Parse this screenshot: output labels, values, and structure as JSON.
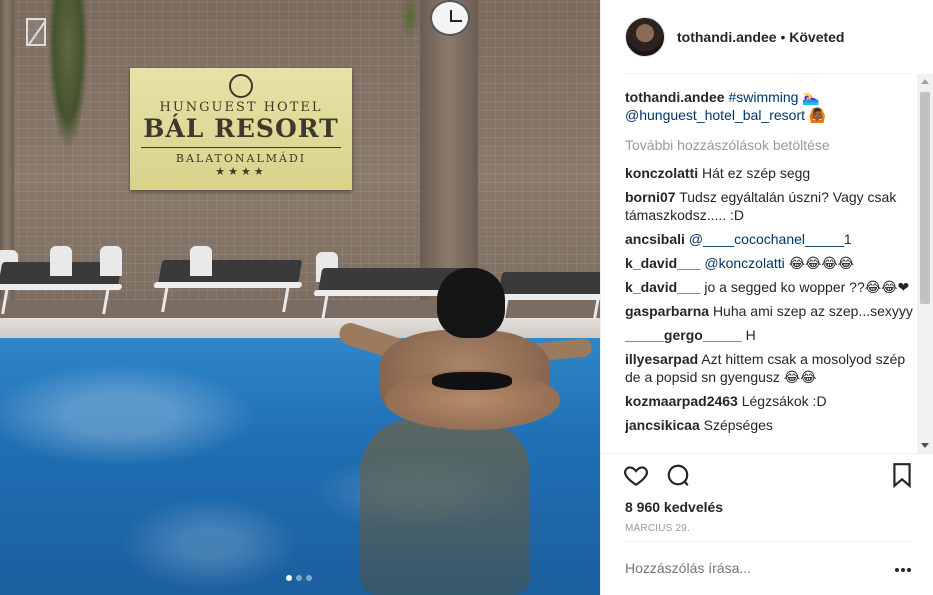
{
  "post": {
    "username": "tothandi.andee",
    "separator": "•",
    "follow_status": "Követed",
    "caption_user": "tothandi.andee",
    "caption_hashtag": "#swimming",
    "caption_tail": "🏊‍♀️",
    "caption_mention": "@hunguest_hotel_bal_resort",
    "caption_emoji": "🙆🏾"
  },
  "photo": {
    "sign": {
      "line1": "HUNGUEST HOTEL",
      "line2": "BÁL RESORT",
      "line3": "BALATONALMÁDI",
      "stars": "★★★★"
    },
    "carousel_count": 3,
    "carousel_active": 0
  },
  "comments": {
    "load_more": "További hozzászólások betöltése",
    "items": [
      {
        "user": "konczolatti",
        "text": "Hát ez szép segg"
      },
      {
        "user": "borni07",
        "text": "Tudsz egyáltalán úszni? Vagy csak támaszkodsz..... :D"
      },
      {
        "user": "ancsibali",
        "mention": "@____cocochanel_____1",
        "text": ""
      },
      {
        "user": "k_david___",
        "mention": "@konczolatti",
        "text": "😂😂😂😂"
      },
      {
        "user": "k_david___",
        "text": "jo a segged ko wopper ??😂😂❤"
      },
      {
        "user": "gasparbarna",
        "text": "Huha ami szep az szep...sexyyy"
      },
      {
        "user": "_____gergo_____",
        "text": "H"
      },
      {
        "user": "illyesarpad",
        "text": "Azt hittem csak a mosolyod szép de a popsid sn gyengusz 😂😂"
      },
      {
        "user": "kozmaarpad2463",
        "text": "Légzsákok :D"
      },
      {
        "user": "jancsikicaa",
        "text": "Szépséges"
      }
    ]
  },
  "actions": {
    "like_icon": "heart-icon",
    "comment_icon": "comment-icon",
    "save_icon": "bookmark-icon",
    "likes_text": "8 960 kedvelés",
    "date_text": "MÁRCIUS 29.",
    "add_comment_placeholder": "Hozzászólás írása...",
    "more_icon": "more-options-icon"
  },
  "colors": {
    "link": "#003569",
    "muted": "#999999",
    "text": "#262626",
    "pool": "#1f6fb4"
  }
}
